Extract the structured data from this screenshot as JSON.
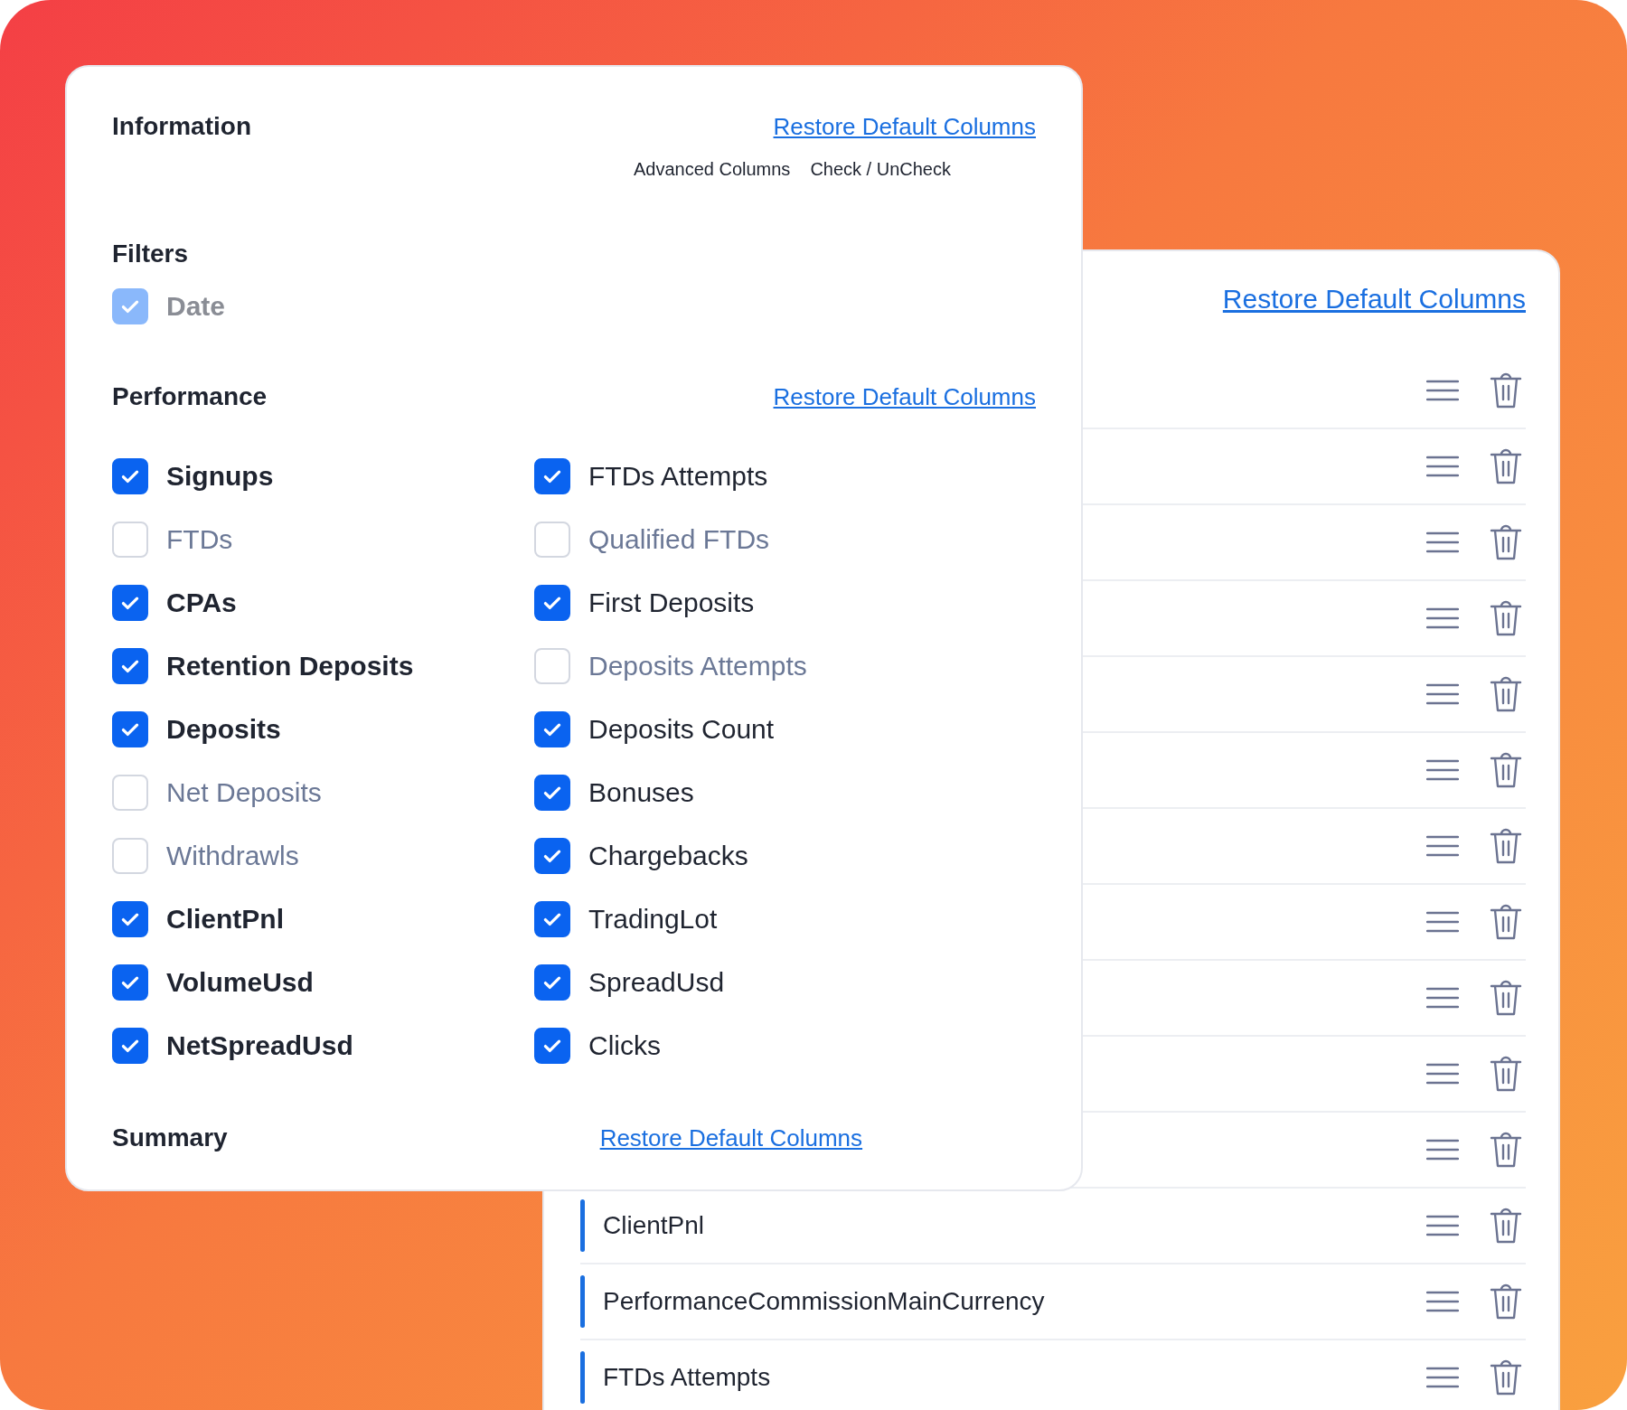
{
  "back_panel": {
    "restore_link": "Restore Default Columns",
    "rows": [
      {
        "kind": "covered"
      },
      {
        "kind": "covered"
      },
      {
        "kind": "covered"
      },
      {
        "kind": "covered"
      },
      {
        "kind": "covered"
      },
      {
        "kind": "covered"
      },
      {
        "kind": "covered"
      },
      {
        "kind": "covered"
      },
      {
        "kind": "covered"
      },
      {
        "kind": "covered"
      },
      {
        "kind": "covered"
      },
      {
        "kind": "column",
        "label": "ClientPnl"
      },
      {
        "kind": "column",
        "label": "PerformanceCommissionMainCurrency"
      },
      {
        "kind": "column",
        "label": "FTDs Attempts"
      }
    ]
  },
  "information": {
    "title": "Information",
    "restore_link": "Restore Default Columns",
    "advanced_columns": "Advanced Columns",
    "check_toggle": "Check / UnCheck"
  },
  "filters": {
    "title": "Filters",
    "items": [
      {
        "label": "Date",
        "checked": true,
        "disabled": true
      }
    ]
  },
  "performance": {
    "title": "Performance",
    "restore_link": "Restore Default Columns",
    "items": [
      {
        "label": "Signups",
        "checked": true
      },
      {
        "label": "FTDs Attempts",
        "checked": true
      },
      {
        "label": "FTDs",
        "checked": false
      },
      {
        "label": "Qualified FTDs",
        "checked": false
      },
      {
        "label": "CPAs",
        "checked": true
      },
      {
        "label": "First Deposits",
        "checked": true
      },
      {
        "label": "Retention Deposits",
        "checked": true
      },
      {
        "label": "Deposits Attempts",
        "checked": false
      },
      {
        "label": "Deposits",
        "checked": true
      },
      {
        "label": "Deposits Count",
        "checked": true
      },
      {
        "label": "Net Deposits",
        "checked": false
      },
      {
        "label": "Bonuses",
        "checked": true
      },
      {
        "label": "Withdrawls",
        "checked": false
      },
      {
        "label": "Chargebacks",
        "checked": true
      },
      {
        "label": "ClientPnl",
        "checked": true
      },
      {
        "label": "TradingLot",
        "checked": true
      },
      {
        "label": "VolumeUsd",
        "checked": true
      },
      {
        "label": "SpreadUsd",
        "checked": true
      },
      {
        "label": "NetSpreadUsd",
        "checked": true
      },
      {
        "label": "Clicks",
        "checked": true
      }
    ]
  },
  "summary": {
    "title": "Summary",
    "restore_link": "Restore Default Columns"
  }
}
